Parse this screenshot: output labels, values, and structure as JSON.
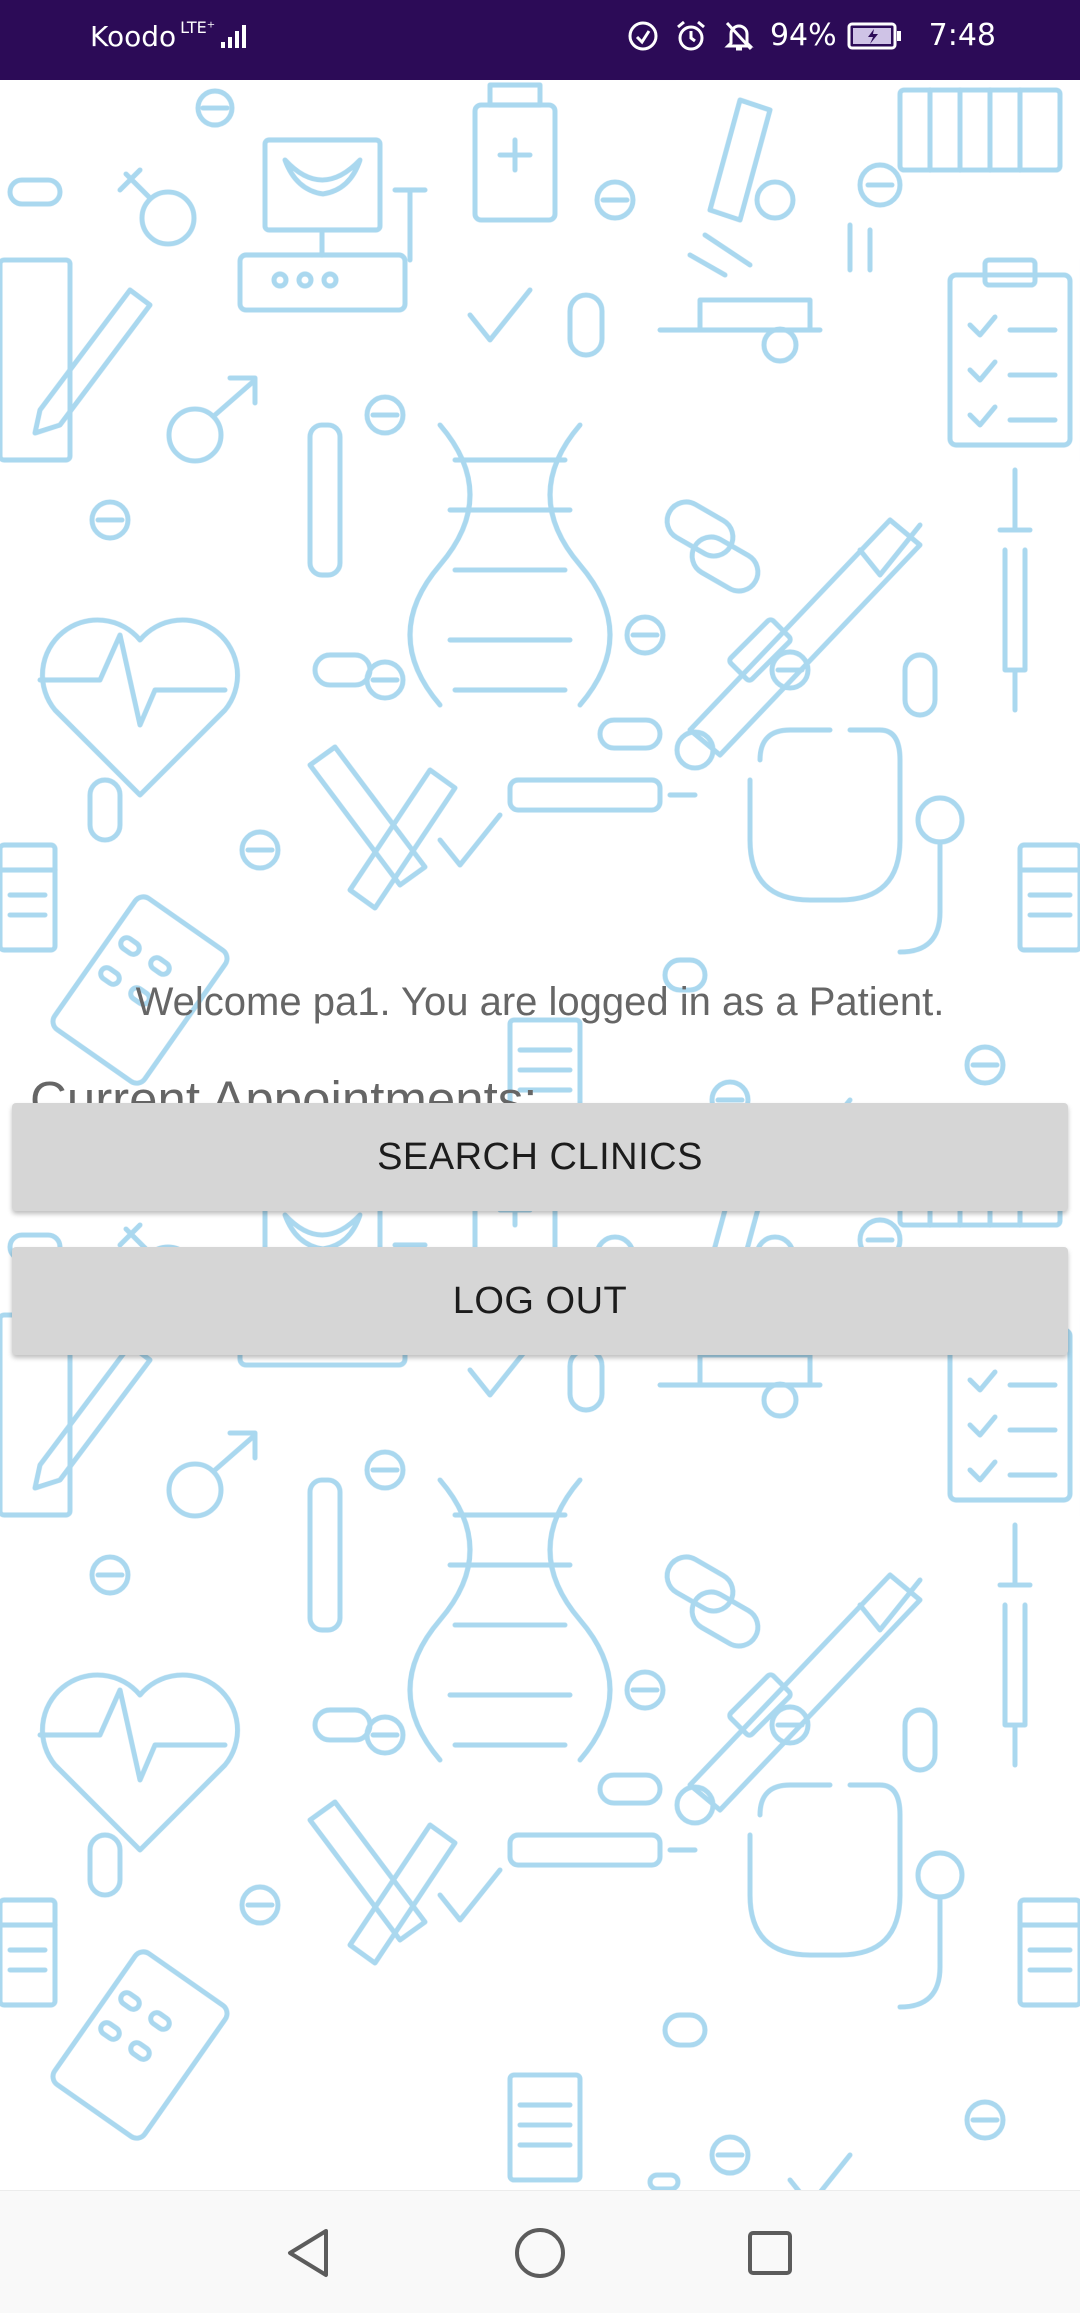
{
  "status_bar": {
    "carrier": "Koodo",
    "network": "LTE⁺",
    "battery_percent": "94%",
    "time": "7:48",
    "icons": [
      "signal-icon",
      "data-saver-icon",
      "alarm-icon",
      "notifications-off-icon",
      "battery-charging-icon"
    ]
  },
  "main": {
    "welcome_text": "Welcome pa1. You are logged in as a Patient.",
    "appointments_heading": "Current Appointments:",
    "search_clinics_label": "SEARCH CLINICS",
    "log_out_label": "LOG OUT"
  },
  "nav_bar": {
    "icons": [
      "back-icon",
      "home-icon",
      "recents-icon"
    ]
  },
  "colors": {
    "status_bar_bg": "#2c0b57",
    "button_bg": "#d6d6d6",
    "text_gray": "#666666",
    "pattern_blue": "#8ecbea"
  }
}
